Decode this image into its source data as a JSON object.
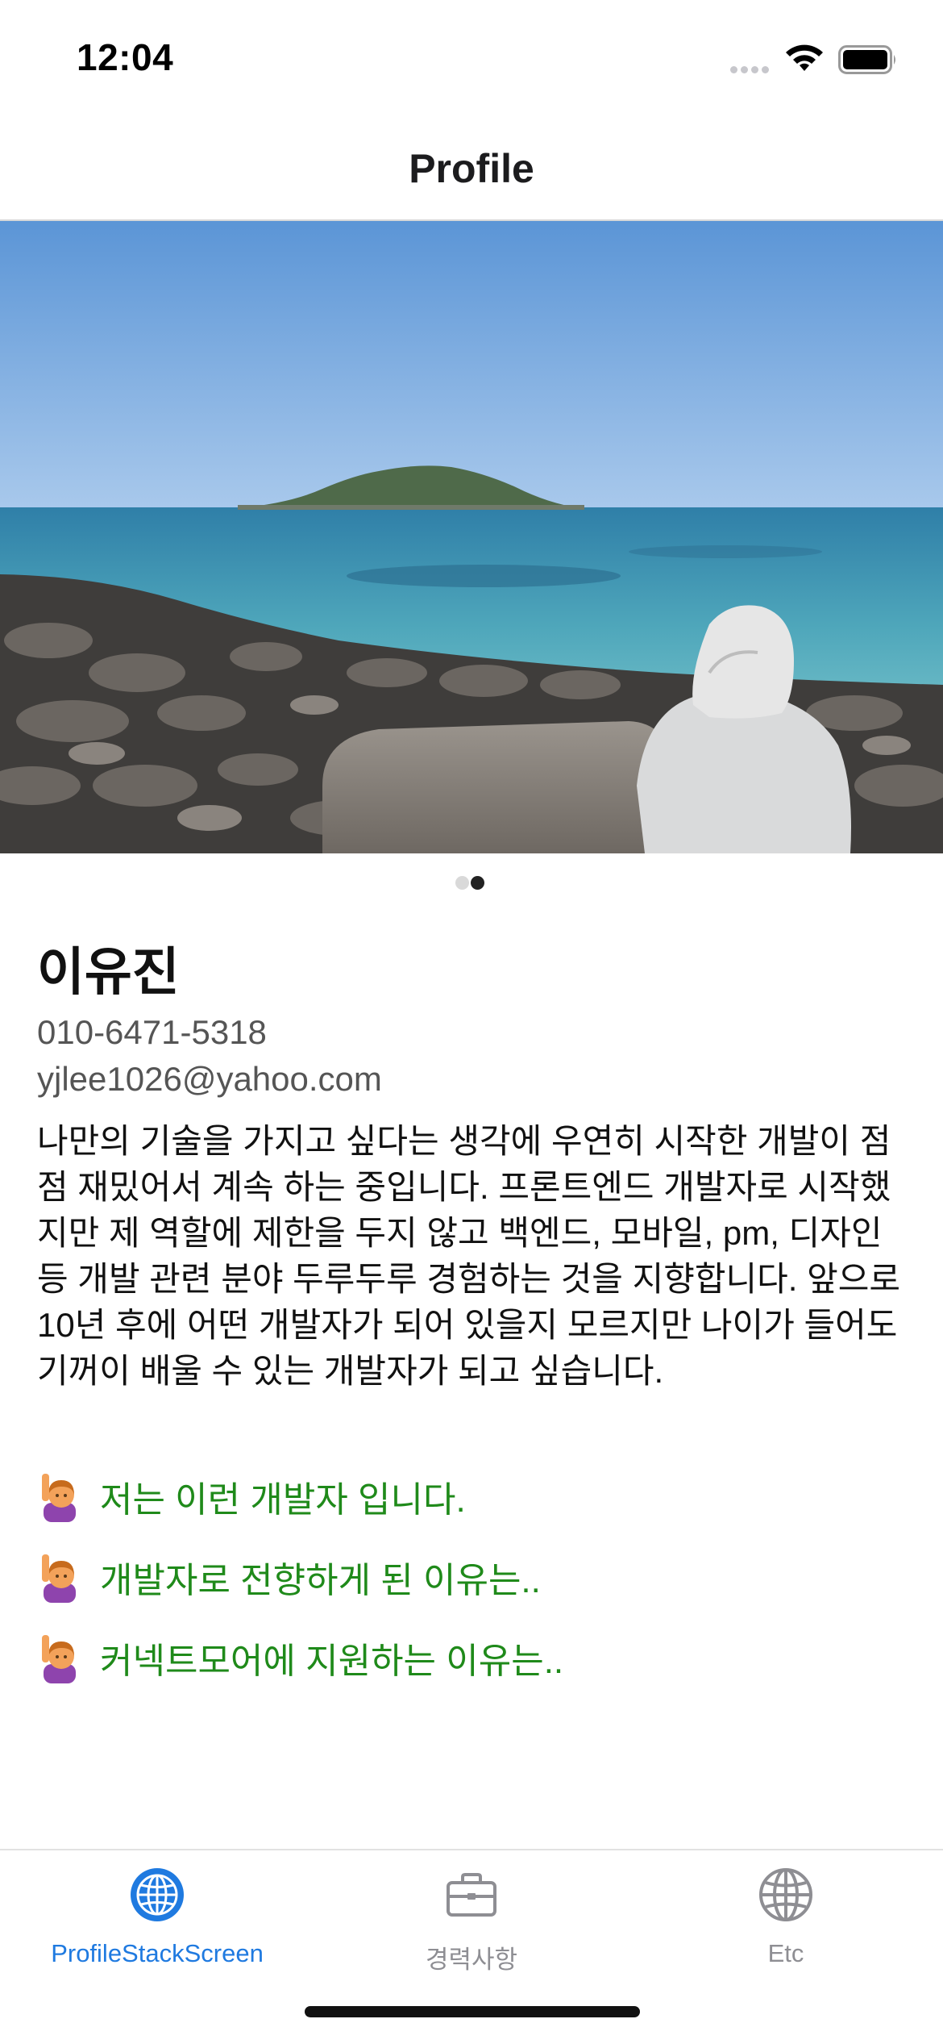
{
  "status_bar": {
    "time": "12:04"
  },
  "header": {
    "title": "Profile"
  },
  "carousel": {
    "page_count": 2,
    "active_index": 1
  },
  "profile": {
    "name": "이유진",
    "phone": "010-6471-5318",
    "email": "yjlee1026@yahoo.com",
    "intro": "나만의 기술을 가지고 싶다는 생각에 우연히 시작한 개발이 점점 재밌어서 계속 하는 중입니다. 프론트엔드 개발자로 시작했지만 제 역할에 제한을 두지 않고 백엔드, 모바일, pm, 디자인 등 개발 관련 분야 두루두루 경험하는 것을 지향합니다. 앞으로 10년 후에 어떤 개발자가 되어 있을지 모르지만 나이가 들어도 기꺼이 배울 수 있는 개발자가 되고 싶습니다."
  },
  "links": [
    {
      "label": "저는 이런 개발자 입니다."
    },
    {
      "label": "개발자로 전향하게 된 이유는.."
    },
    {
      "label": "커넥트모어에 지원하는 이유는.."
    }
  ],
  "tabs": [
    {
      "label": "ProfileStackScreen",
      "icon": "globe-icon",
      "active": true
    },
    {
      "label": "경력사항",
      "icon": "briefcase-icon",
      "active": false
    },
    {
      "label": "Etc",
      "icon": "globe-icon",
      "active": false
    }
  ],
  "colors": {
    "accent": "#1f7ae0",
    "link": "#1f8a1a",
    "inactive_tab": "#8e8e93"
  }
}
